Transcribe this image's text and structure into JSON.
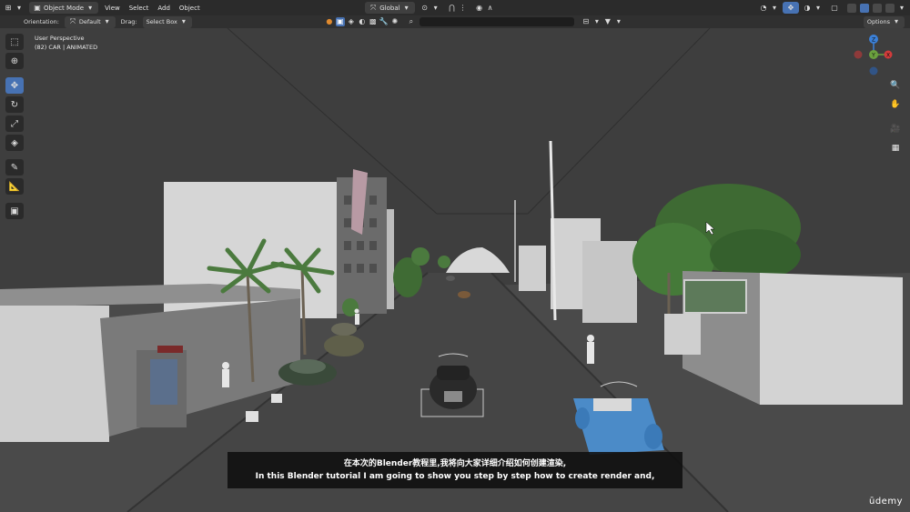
{
  "header": {
    "mode": "Object Mode",
    "menus": [
      "View",
      "Select",
      "Add",
      "Object"
    ],
    "transform_orientation": "Global",
    "options_label": "Options"
  },
  "tool_header": {
    "orientation_label": "Orientation:",
    "orientation_value": "Default",
    "drag_label": "Drag:",
    "drag_value": "Select Box"
  },
  "viewport": {
    "view_name": "User Perspective",
    "active_object": "(82) CAR | ANIMATED"
  },
  "gizmo": {
    "axes": [
      {
        "label": "Z",
        "color": "#3b80d8"
      },
      {
        "label": "Y",
        "color": "#6ba13e"
      },
      {
        "label": "X",
        "color": "#d33b3b"
      }
    ]
  },
  "toolbar": {
    "tools": [
      "select-box",
      "cursor",
      "move",
      "rotate",
      "scale",
      "transform",
      "annotate",
      "measure",
      "add-cube"
    ],
    "active": "move"
  },
  "subtitles": {
    "line_zh": "在本次的Blender教程里,我将向大家详细介绍如何创建渲染,",
    "line_en": "In this Blender tutorial I am going to show you step by step how to create render and,"
  },
  "brand": "ūdemy",
  "colors": {
    "accent": "#4772b3",
    "background": "#3d3d3d",
    "header": "#2b2b2b"
  }
}
